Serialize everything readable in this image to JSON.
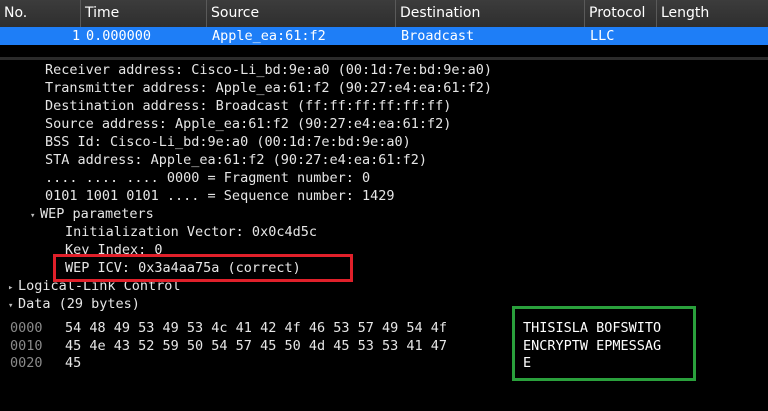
{
  "columns": [
    "No.",
    "Time",
    "Source",
    "Destination",
    "Protocol",
    "Length"
  ],
  "packet": {
    "no": "1",
    "time": "0.000000",
    "source": "Apple_ea:61:f2",
    "destination": "Broadcast",
    "protocol": "LLC",
    "length": ""
  },
  "details": [
    "Receiver address: Cisco-Li_bd:9e:a0 (00:1d:7e:bd:9e:a0)",
    "Transmitter address: Apple_ea:61:f2 (90:27:e4:ea:61:f2)",
    "Destination address: Broadcast (ff:ff:ff:ff:ff:ff)",
    "Source address: Apple_ea:61:f2 (90:27:e4:ea:61:f2)",
    "BSS Id: Cisco-Li_bd:9e:a0 (00:1d:7e:bd:9e:a0)",
    "STA address: Apple_ea:61:f2 (90:27:e4:ea:61:f2)",
    ".... .... .... 0000 = Fragment number: 0",
    "0101 1001 0101 .... = Sequence number: 1429"
  ],
  "wep": {
    "label": "WEP parameters",
    "iv": "Initialization Vector: 0x0c4d5c",
    "key_index": "Key Index: 0",
    "icv": "WEP ICV: 0x3a4aa75a (correct)"
  },
  "llc": "Logical-Link Control",
  "data_label": "Data (29 bytes)",
  "hex_rows": [
    {
      "offset": "0000",
      "hex": "54 48 49 53 49 53 4c 41  42 4f 46 53 57 49 54 4f",
      "ascii": "THISISLA BOFSWITO"
    },
    {
      "offset": "0010",
      "hex": "45 4e 43 52 59 50 54 57  45 50 4d 45 53 53 41 47",
      "ascii": "ENCRYPTW EPMESSAG"
    },
    {
      "offset": "0020",
      "hex": "45",
      "ascii": "E"
    }
  ],
  "colors": {
    "selected_row": "#1e7ef7",
    "highlight_red": "#e0202a",
    "highlight_green": "#2aa03c"
  }
}
